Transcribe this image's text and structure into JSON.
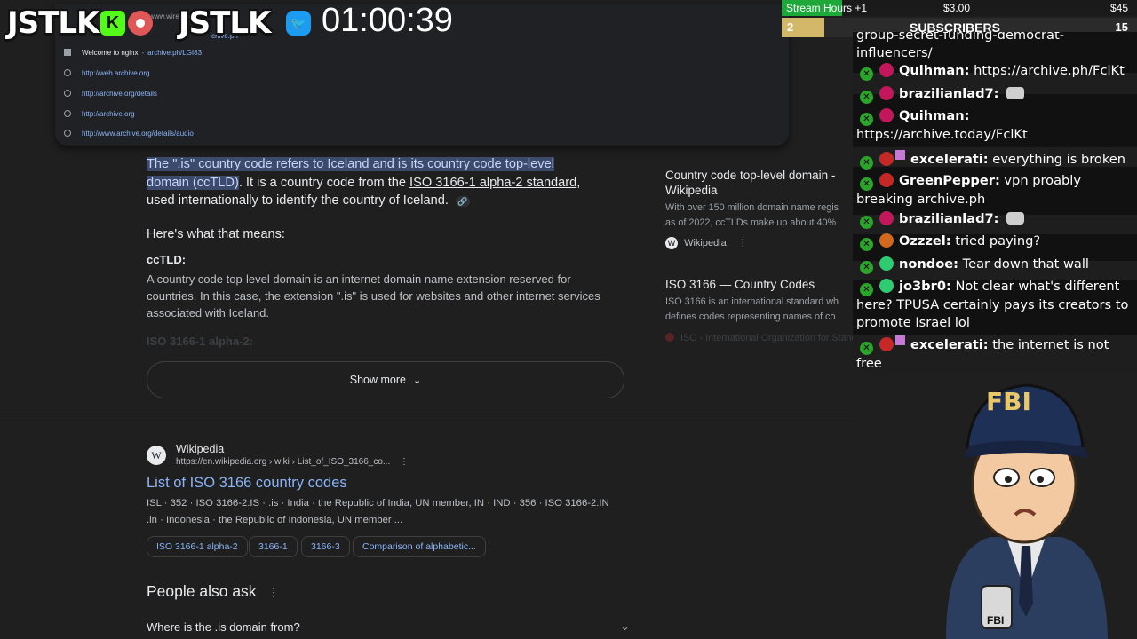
{
  "overlay": {
    "brand_left": "JSTLK",
    "brand_right": "JSTLK",
    "timer": "01:00:39"
  },
  "stats": {
    "stream_hours": "Stream Hours +1",
    "amount1": "$3.00",
    "amount2": "$45",
    "subscribers_label": "SUBSCRIBERS",
    "sub_left": "2",
    "sub_right": "15"
  },
  "address_bar": {
    "partial_url": "www.wired.com",
    "partial_url2": "chive.ph"
  },
  "dropdown": {
    "items": [
      {
        "title": "Welcome to nginx",
        "url": "archive.ph/LGI83"
      },
      {
        "title": "",
        "url": "http://web.archive.org"
      },
      {
        "title": "",
        "url": "http://archive.org/details"
      },
      {
        "title": "",
        "url": "http://archive.org"
      },
      {
        "title": "",
        "url": "http://www.archive.org/details/audio"
      }
    ]
  },
  "answer": {
    "hl1": "The \".is\" country code refers to Iceland and is its country code top-level",
    "hl2": "domain (ccTLD)",
    "rest1": ". It is a country code from the ",
    "link1": "ISO 3166-1 alpha-2 standard",
    "rest2": ",",
    "line3": "used internationally to identify the country of Iceland.",
    "means_heading": "Here's what that means:",
    "cctld_heading": "ccTLD:",
    "cctld_text": "A country code top-level domain is an internet domain name extension reserved for countries. In this case, the extension \".is\" is used for websites and other internet services associated with Iceland.",
    "faded_heading": "ISO 3166-1 alpha-2:",
    "show_more": "Show more"
  },
  "right_panel": {
    "card1_title": "Country code top-level domain - Wikipedia",
    "card1_text1": "With over 150 million domain name regis",
    "card1_text2": "as of 2022, ccTLDs make up about 40%",
    "card1_source": "Wikipedia",
    "card2_title": "ISO 3166 — Country Codes",
    "card2_text1": "ISO 3166 is an international standard wh",
    "card2_text2": "defines codes representing names of co",
    "card2_source": "ISO - International Organization for Stand"
  },
  "result": {
    "site_name": "Wikipedia",
    "site_url": "https://en.wikipedia.org › wiki › List_of_ISO_3166_co...",
    "title": "List of ISO 3166 country codes",
    "snippet1": "ISL · 352 · ISO 3166-2:IS · .is · India · the Republic of India, UN member, IN · IND · 356 · ISO 3166-2:IN",
    "snippet2": ".in · Indonesia · the Republic of Indonesia, UN member ...",
    "chips": [
      "ISO 3166-1 alpha-2",
      "3166-1",
      "3166-3",
      "Comparison of alphabetic..."
    ]
  },
  "paa": {
    "heading": "People also ask",
    "q1": "Where is the .is domain from?"
  },
  "chat": {
    "messages": [
      {
        "user": "",
        "text": "group-secret-funding-democrat-influencers/"
      },
      {
        "user": "Quihman:",
        "text": "https://archive.ph/FclKt"
      },
      {
        "user": "brazilianlad7:",
        "text": ""
      },
      {
        "user": "Quihman:",
        "text": "https://archive.today/FclKt"
      },
      {
        "user": "excelerati:",
        "text": "everything is broken"
      },
      {
        "user": "GreenPepper:",
        "text": "vpn proably breaking archive.ph"
      },
      {
        "user": "brazilianlad7:",
        "text": ""
      },
      {
        "user": "Ozzzel:",
        "text": "tried paying?"
      },
      {
        "user": "nondoe:",
        "text": "Tear down that wall"
      },
      {
        "user": "jo3br0:",
        "text": "Not clear what's different here? TPUSA certainly pays its creators to promote Israel lol"
      },
      {
        "user": "excelerati:",
        "text": "the internet is not free"
      }
    ]
  },
  "mascot": {
    "cap_text": "FBI",
    "badge_text": "FBI"
  },
  "colors": {
    "background": "#1f1f1f",
    "link": "#8ab4f8",
    "highlight": "#3c4a6b",
    "stream_green": "#1fa83a"
  }
}
